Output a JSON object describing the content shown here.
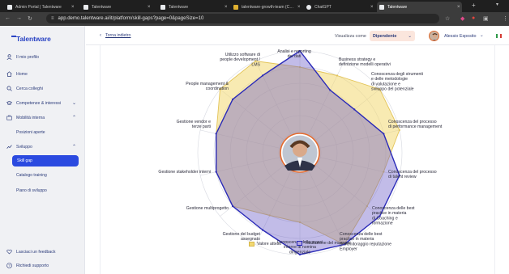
{
  "browser": {
    "tabs": [
      {
        "label": "Admin Portal | Talentware",
        "active": false
      },
      {
        "label": "Talentware",
        "active": false
      },
      {
        "label": "Talentware",
        "active": false
      },
      {
        "label": "talentware-growth-team (Canv...",
        "active": false
      },
      {
        "label": "ChatGPT",
        "active": false
      },
      {
        "label": "Talentware",
        "active": true
      }
    ],
    "url": "app.demo.talentware.ai/it/platform/skill-gaps?page=0&pageSize=10"
  },
  "sidebar": {
    "logo": "Talentware",
    "items": [
      {
        "label": "Il mio profilo",
        "icon": "user-icon"
      },
      {
        "label": "Home",
        "icon": "home-icon"
      },
      {
        "label": "Cerca colleghi",
        "icon": "search-icon"
      },
      {
        "label": "Competenze & interessi",
        "icon": "graduation-cap-icon"
      },
      {
        "label": "Mobilità interna",
        "icon": "briefcase-icon"
      },
      {
        "label": "Sviluppo",
        "icon": "trend-icon"
      }
    ],
    "sub_mobility": [
      "Posizioni aperte"
    ],
    "sub_development": [
      "Skill gap",
      "Catalogo training",
      "Piano di sviluppo"
    ],
    "footer": [
      {
        "label": "Lasciaci un feedback",
        "icon": "heart-icon"
      },
      {
        "label": "Richiedi supporto",
        "icon": "help-icon"
      }
    ]
  },
  "header": {
    "back_label": "Torna indietro",
    "view_as_label": "Visualizza come",
    "view_as_value": "Dipendente",
    "user_name": "Alessio Esposito"
  },
  "chart_data": {
    "type": "radar",
    "axes": [
      "Analisi e reporting dei dati",
      "Business strategy e definizione modelli operativi",
      "Conoscenza degli strumenti e delle metodologie di valutazione e sviluppo del potenziale",
      "Conoscenza del processo di performance management",
      "Conoscenza del processo di talent review",
      "Conoscenza delle best practice in materia di Coaching e formazione",
      "Conoscenza delle best practice in materia di monitoraggio reputazione Employer",
      "Conoscenza delle prassi interne di nomina dirigenziale",
      "Gestione del budget assegnato",
      "Gestione multiprogetto",
      "Gestione stakeholder interni",
      "Gestione vendor e terze parti",
      "People management & coordination",
      "Utilizzo software di people development / LMS"
    ],
    "axis_label_lines": [
      [
        "Analisi e reporting",
        "dei dati"
      ],
      [
        "Business strategy e",
        "definizione modelli operativi"
      ],
      [
        "Conoscenza degli strumenti",
        "e delle metodologie",
        "di valutazione e",
        "sviluppo del potenziale"
      ],
      [
        "Conoscenza del processo",
        "di performance management"
      ],
      [
        "Conoscenza del processo",
        "di talent review"
      ],
      [
        "Conoscenza delle best",
        "practice in materia",
        "di Coaching e",
        "formazione"
      ],
      [
        "Conoscenza delle best",
        "practice in materia",
        "di monitoraggio reputazione",
        "Employer"
      ],
      [
        "Conoscenza delle prassi",
        "interne di nomina",
        "dirigenziale"
      ],
      [
        "Gestione del budget",
        "assegnato"
      ],
      [
        "Gestione multiprogetto"
      ],
      [
        "Gestione stakeholder interni"
      ],
      [
        "Gestione vendor e",
        "terze parti"
      ],
      [
        "People management &",
        "coordination"
      ],
      [
        "Utilizzo software di",
        "people development /",
        "LMS"
      ]
    ],
    "levels": 5,
    "max": 5,
    "series": [
      {
        "name": "Valore atteso",
        "color": "#f2d873",
        "values": [
          4,
          4,
          5,
          5,
          4,
          4,
          5,
          3,
          3,
          4,
          4,
          4,
          5,
          5
        ]
      },
      {
        "name": "Valutazione del manager",
        "color": "#2a2ab8",
        "values": [
          5,
          3,
          3,
          4,
          5,
          5,
          5,
          5,
          4,
          4,
          4,
          4,
          4,
          4
        ]
      }
    ]
  },
  "legend": {
    "info_icon": "info-icon"
  }
}
